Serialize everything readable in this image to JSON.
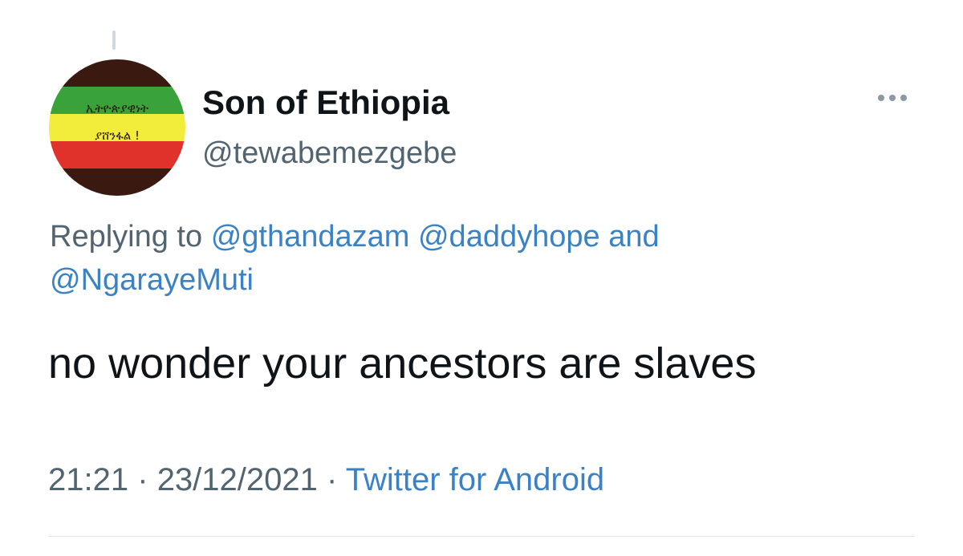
{
  "tweet": {
    "author": {
      "display_name": "Son of Ethiopia",
      "handle": "@tewabemezgebe",
      "avatar_text_line1": "ኢትዮጵያዊነት",
      "avatar_text_line2": "ያሸንፋል !",
      "avatar_colors": [
        "#3a1a10",
        "#3aa23a",
        "#f2ec3a",
        "#e0322a",
        "#3a1a10"
      ]
    },
    "reply_context": {
      "prefix": "Replying to",
      "mentions": [
        "@gthandazam",
        "@daddyhope",
        "@NgarayeMuti"
      ],
      "conjunction": "and"
    },
    "text": "no wonder your ancestors are slaves",
    "time": "21:21",
    "separator": "·",
    "date": "23/12/2021",
    "source": "Twitter for Android",
    "more_icon": "more-horizontal-icon"
  }
}
